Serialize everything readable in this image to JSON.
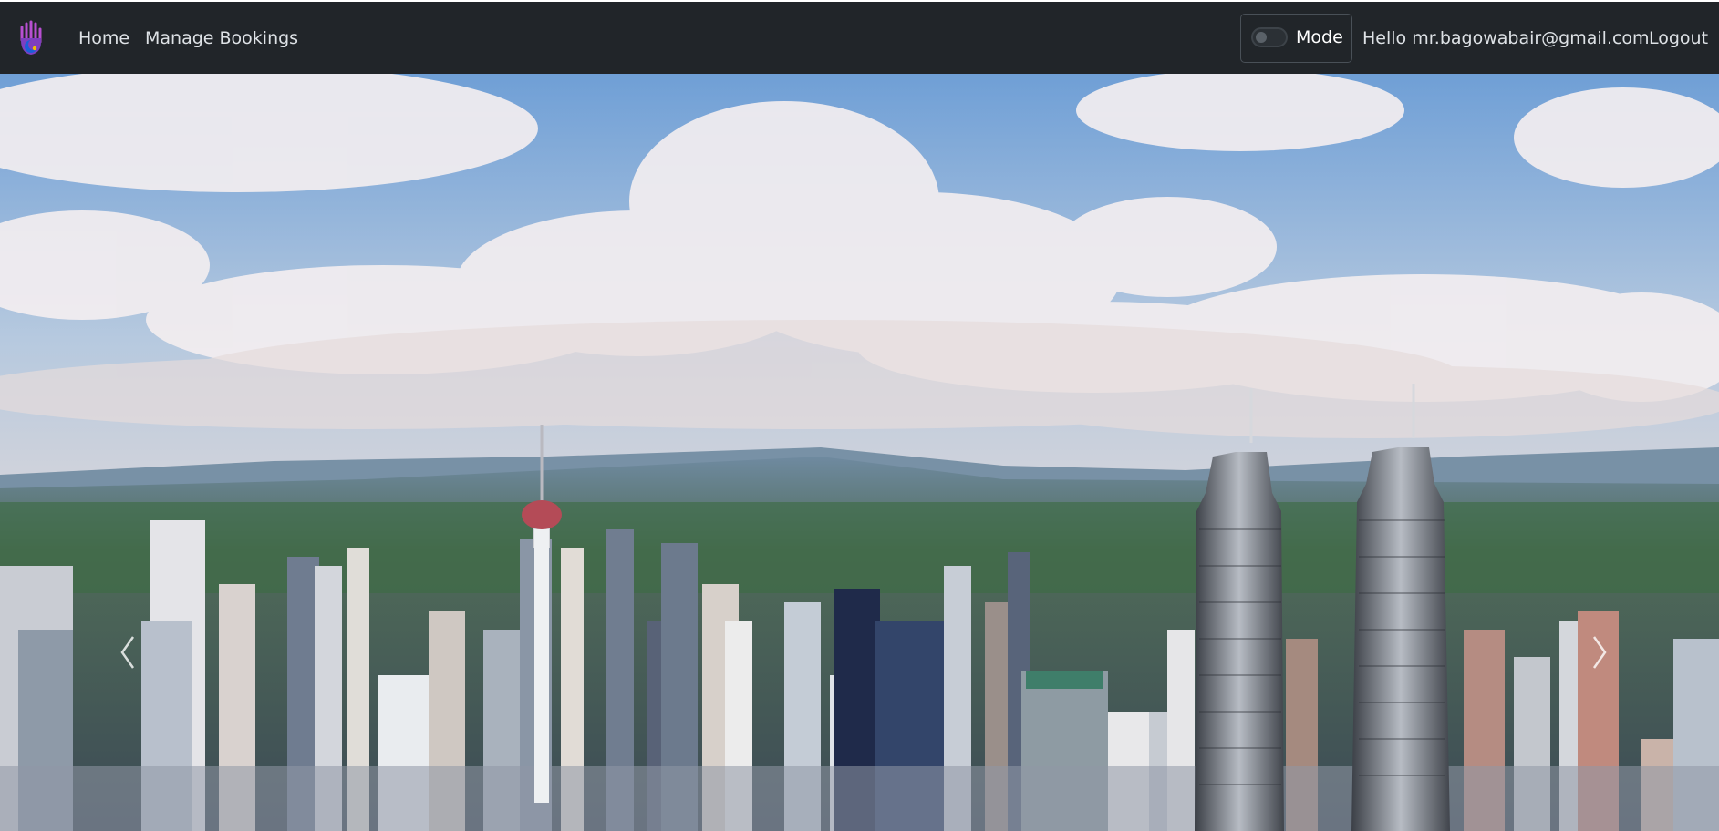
{
  "navbar": {
    "brand_icon": "hand-crescent-logo-icon",
    "links": [
      {
        "label": "Home"
      },
      {
        "label": "Manage Bookings"
      }
    ],
    "mode_toggle": {
      "label": "Mode",
      "checked": false
    },
    "greeting": "Hello mr.bagowabair@gmail.com",
    "logout_label": "Logout"
  },
  "carousel": {
    "prev_icon": "chevron-left-icon",
    "next_icon": "chevron-right-icon",
    "slide_image": "kuala-lumpur-skyline-photo"
  },
  "colors": {
    "navbar_bg": "#212529",
    "nav_text": "#dee2e6"
  }
}
